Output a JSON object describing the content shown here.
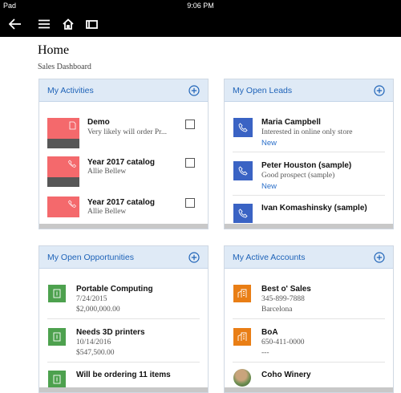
{
  "status_bar": {
    "device": "Pad",
    "time": "9:06 PM"
  },
  "page": {
    "title": "Home",
    "subtitle": "Sales Dashboard"
  },
  "activities": {
    "title": "My Activities",
    "items": [
      {
        "title": "Demo",
        "line1": "Very likely will order Pr..."
      },
      {
        "title": "Year 2017 catalog",
        "line1": "Allie Bellew"
      },
      {
        "title": "Year 2017 catalog",
        "line1": "Allie Bellew"
      }
    ]
  },
  "leads": {
    "title": "My Open Leads",
    "items": [
      {
        "title": "Maria Campbell",
        "line1": "Interested in online only store",
        "status": "New"
      },
      {
        "title": "Peter Houston (sample)",
        "line1": "Good prospect (sample)",
        "status": "New"
      },
      {
        "title": "Ivan Komashinsky (sample)",
        "line1": "",
        "status": ""
      }
    ]
  },
  "opportunities": {
    "title": "My Open Opportunities",
    "items": [
      {
        "title": "Portable Computing",
        "line1": "7/24/2015",
        "line2": "$2,000,000.00"
      },
      {
        "title": "Needs 3D printers",
        "line1": "10/14/2016",
        "line2": "$547,500.00"
      },
      {
        "title": "Will be ordering 11 items",
        "line1": "",
        "line2": ""
      }
    ]
  },
  "accounts": {
    "title": "My Active Accounts",
    "items": [
      {
        "title": "Best o' Sales",
        "line1": "345-899-7888",
        "line2": "Barcelona"
      },
      {
        "title": "BoA",
        "line1": "650-411-0000",
        "line2": "---"
      },
      {
        "title": "Coho Winery",
        "line1": "",
        "line2": ""
      }
    ]
  },
  "colors": {
    "header_bg": "#dfeaf6",
    "accent": "#1e63b8",
    "activity": "#f4696c",
    "lead": "#3a63c4",
    "opportunity": "#4da14e",
    "account": "#e97e15"
  }
}
